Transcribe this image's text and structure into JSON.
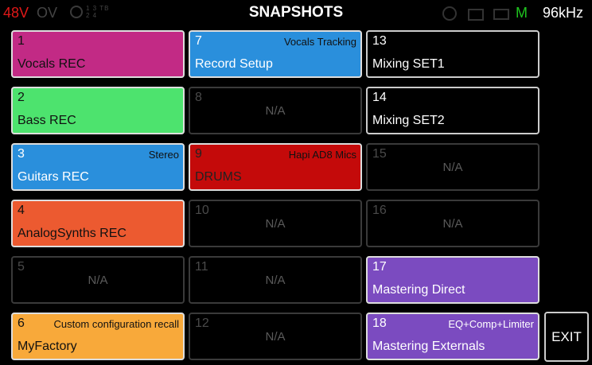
{
  "status": {
    "phantom": "48V",
    "overload": "OV",
    "channels": "1 3 TB\n2 4",
    "monitor": "M",
    "sample_rate": "96kHz",
    "phantom_color": "#e01818",
    "monitor_color": "#1fc41f"
  },
  "title": "SNAPSHOTS",
  "snapshots": [
    {
      "num": "1",
      "name": "Vocals REC",
      "tag": "",
      "color": "#c22a85",
      "state": "filled"
    },
    {
      "num": "2",
      "name": "Bass REC",
      "tag": "",
      "color": "#4de36e",
      "state": "filled"
    },
    {
      "num": "3",
      "name": "Guitars REC",
      "tag": "Stereo",
      "color": "#2a8fdc",
      "state": "filled"
    },
    {
      "num": "4",
      "name": "AnalogSynths REC",
      "tag": "",
      "color": "#ec5a30",
      "state": "filled"
    },
    {
      "num": "5",
      "name": "N/A",
      "tag": "",
      "color": "#000000",
      "state": "empty"
    },
    {
      "num": "6",
      "name": "MyFactory",
      "tag": "Custom configuration recall",
      "color": "#f8a93a",
      "state": "filled"
    },
    {
      "num": "7",
      "name": "Record Setup",
      "tag": "Vocals Tracking",
      "color": "#2a8fdc",
      "state": "filled"
    },
    {
      "num": "8",
      "name": "N/A",
      "tag": "",
      "color": "#000000",
      "state": "empty"
    },
    {
      "num": "9",
      "name": "DRUMS",
      "tag": "Hapi AD8 Mics",
      "color": "#c40a0a",
      "state": "filled"
    },
    {
      "num": "10",
      "name": "N/A",
      "tag": "",
      "color": "#000000",
      "state": "empty"
    },
    {
      "num": "11",
      "name": "N/A",
      "tag": "",
      "color": "#000000",
      "state": "empty"
    },
    {
      "num": "12",
      "name": "N/A",
      "tag": "",
      "color": "#000000",
      "state": "empty"
    },
    {
      "num": "13",
      "name": "Mixing SET1",
      "tag": "",
      "color": "#000000",
      "state": "filled"
    },
    {
      "num": "14",
      "name": "Mixing SET2",
      "tag": "",
      "color": "#000000",
      "state": "filled"
    },
    {
      "num": "15",
      "name": "N/A",
      "tag": "",
      "color": "#000000",
      "state": "empty"
    },
    {
      "num": "16",
      "name": "N/A",
      "tag": "",
      "color": "#000000",
      "state": "empty"
    },
    {
      "num": "17",
      "name": "Mastering Direct",
      "tag": "",
      "color": "#7b4bc0",
      "state": "filled"
    },
    {
      "num": "18",
      "name": "Mastering Externals",
      "tag": "EQ+Comp+Limiter",
      "color": "#7b4bc0",
      "state": "filled"
    }
  ],
  "exit_label": "EXIT"
}
